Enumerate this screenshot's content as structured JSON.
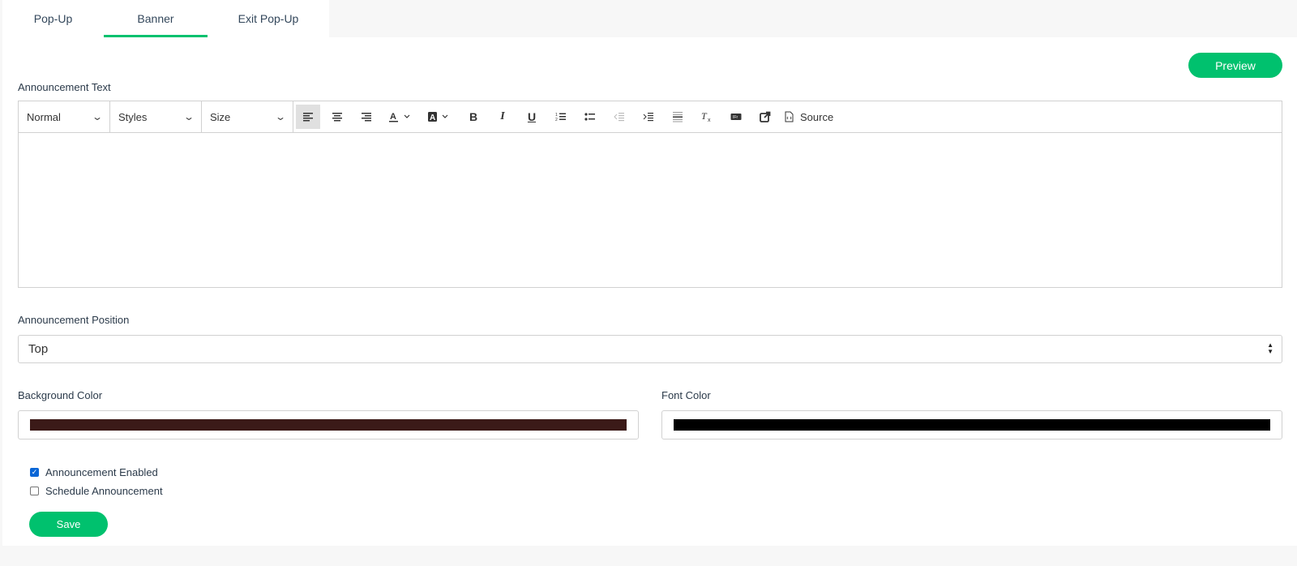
{
  "tabs": [
    {
      "label": "Pop-Up",
      "active": false
    },
    {
      "label": "Banner",
      "active": true
    },
    {
      "label": "Exit Pop-Up",
      "active": false
    }
  ],
  "preview_label": "Preview",
  "announcement_text": {
    "label": "Announcement Text",
    "toolbar": {
      "format_select": "Normal",
      "styles_select": "Styles",
      "size_select": "Size",
      "source_label": "Source",
      "icons": [
        "align-left-icon",
        "align-center-icon",
        "align-right-icon",
        "text-color-icon",
        "background-color-icon",
        "bold-icon",
        "italic-icon",
        "underline-icon",
        "numbered-list-icon",
        "bulleted-list-icon",
        "outdent-icon",
        "indent-icon",
        "horizontal-rule-icon",
        "remove-format-icon",
        "iframe-icon",
        "link-icon",
        "source-icon"
      ]
    },
    "content": ""
  },
  "position": {
    "label": "Announcement Position",
    "value": "Top"
  },
  "background_color": {
    "label": "Background Color",
    "value": "#3b1a18"
  },
  "font_color": {
    "label": "Font Color",
    "value": "#000000"
  },
  "checkboxes": [
    {
      "label": "Announcement Enabled",
      "checked": true
    },
    {
      "label": "Schedule Announcement",
      "checked": false
    }
  ],
  "save_label": "Save",
  "colors": {
    "accent": "#00c16e",
    "checkbox": "#0a66d6"
  }
}
